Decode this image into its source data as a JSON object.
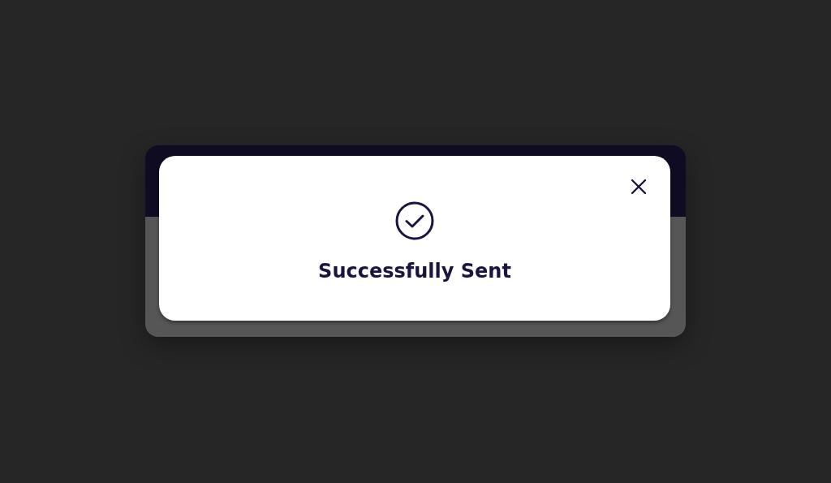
{
  "dialog": {
    "message": "Successfully Sent"
  }
}
